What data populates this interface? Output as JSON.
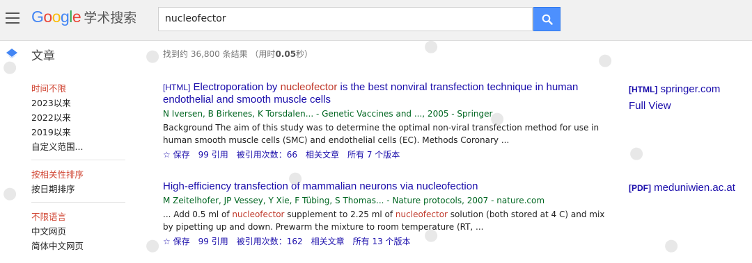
{
  "header": {
    "logo_google": [
      "G",
      "o",
      "o",
      "g",
      "l",
      "e"
    ],
    "logo_colors": [
      "#4285f4",
      "#ea4335",
      "#fbbc05",
      "#4285f4",
      "#34a853",
      "#ea4335"
    ],
    "logo_suffix": "学术搜索",
    "search_query": "nucleofector",
    "search_icon": "magnifier-icon",
    "accent": "#4d90fe"
  },
  "subbar": {
    "section_label": "文章",
    "result_count_prefix": "找到约 36,800 条结果 （用时",
    "result_count_time": "0.05",
    "result_count_suffix": "秒）"
  },
  "sidebar": {
    "time_filters": [
      "时间不限",
      "2023以来",
      "2022以来",
      "2019以来",
      "自定义范围..."
    ],
    "sort_options": [
      "按相关性排序",
      "按日期排序"
    ],
    "language_options": [
      "不限语言",
      "中文网页",
      "简体中文网页"
    ]
  },
  "results": [
    {
      "tag": "[HTML]",
      "title_pre": "Electroporation by ",
      "title_hl": "nucleofector",
      "title_post": " is the best nonviral transfection technique in human endothelial and smooth muscle cells",
      "authors": "N Iversen, B Birkenes, K Torsdalen... - Genetic Vaccines and ..., 2005 - Springer",
      "snippet": "Background The aim of this study was to determine the optimal non-viral transfection method for use in human smooth muscle cells (SMC) and endothelial cells (EC). Methods Coronary ...",
      "save": "保存",
      "cite": "引用",
      "cited_by": "被引用次数：66",
      "related": "相关文章",
      "versions": "所有 7 个版本",
      "side_type": "[HTML]",
      "side_domain": "springer.com",
      "side_extra": "Full View"
    },
    {
      "tag": "",
      "title_pre": "High-efficiency transfection of mammalian neurons via nucleofection",
      "title_hl": "",
      "title_post": "",
      "authors": "M Zeitelhofer, JP Vessey, Y Xie, F Tübing, S Thomas... - Nature protocols, 2007 - nature.com",
      "snippet_parts": [
        "... Add 0.5 ml of ",
        "nucleofector",
        " supplement to 2.25 ml of ",
        "nucleofector",
        " solution (both stored at 4 C) and mix by pipetting up and down. Prewarm the mixture to room temperature (RT, ..."
      ],
      "save": "保存",
      "cite": "引用",
      "cited_by": "被引用次数：162",
      "related": "相关文章",
      "versions": "所有 13 个版本",
      "side_type": "[PDF]",
      "side_domain": "meduniwien.ac.at"
    }
  ]
}
